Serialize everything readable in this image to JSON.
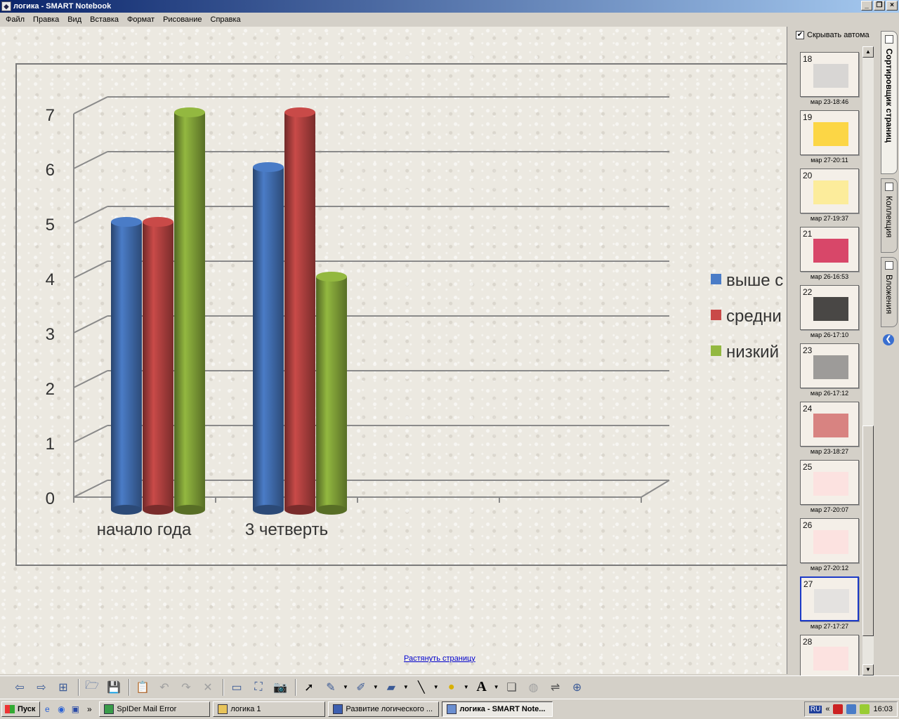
{
  "window": {
    "title": "логика - SMART Notebook",
    "app_icon": "smart-notebook-icon",
    "controls": [
      "_",
      "❐",
      "×"
    ]
  },
  "menu": [
    "Файл",
    "Правка",
    "Вид",
    "Вставка",
    "Формат",
    "Рисование",
    "Справка"
  ],
  "page": {
    "stretch_link": "Растянуть страницу"
  },
  "chart_data": {
    "type": "bar",
    "categories": [
      "начало года",
      "3 четверть"
    ],
    "series": [
      {
        "name": "выше с",
        "color": "#4a7cc7",
        "values": [
          5,
          6
        ]
      },
      {
        "name": "средни",
        "color": "#c94a48",
        "values": [
          5,
          7
        ]
      },
      {
        "name": "низкий",
        "color": "#93b840",
        "values": [
          7,
          4
        ]
      }
    ],
    "yticks": [
      "0",
      "1",
      "2",
      "3",
      "4",
      "5",
      "6",
      "7"
    ],
    "ylim": [
      0,
      7
    ],
    "grid": true,
    "legend": "right",
    "style": "3d-cylinder"
  },
  "sidebar": {
    "hide_label": "Скрывать автома",
    "hide_checked": true,
    "thumbs": [
      {
        "num": "18",
        "date": "мар 23-18:46",
        "selected": false
      },
      {
        "num": "19",
        "date": "мар 27-20:11",
        "selected": false
      },
      {
        "num": "20",
        "date": "мар 27-19:37",
        "selected": false
      },
      {
        "num": "21",
        "date": "мар 26-16:53",
        "selected": false
      },
      {
        "num": "22",
        "date": "мар 26-17:10",
        "selected": false
      },
      {
        "num": "23",
        "date": "мар 26-17:12",
        "selected": false
      },
      {
        "num": "24",
        "date": "мар 23-18:27",
        "selected": false
      },
      {
        "num": "25",
        "date": "мар 27-20:07",
        "selected": false
      },
      {
        "num": "26",
        "date": "мар 27-20:12",
        "selected": false
      },
      {
        "num": "27",
        "date": "мар 27-17:27",
        "selected": true
      },
      {
        "num": "28",
        "date": "",
        "selected": false
      }
    ]
  },
  "tabs": [
    "Сортировщик страниц",
    "Коллекция",
    "Вложения"
  ],
  "toolbar": {
    "icons": [
      "prev-page-icon",
      "next-page-icon",
      "add-page-icon",
      "open-file-icon",
      "save-icon",
      "paste-icon",
      "undo-icon",
      "redo-icon",
      "delete-icon",
      "screen-shade-icon",
      "full-screen-icon",
      "screen-capture-icon",
      "select-icon",
      "pen-icon",
      "creative-pen-icon",
      "eraser-icon",
      "line-icon",
      "shape-icon",
      "text-icon",
      "properties-icon",
      "fill-icon",
      "more-icon",
      "move-toolbar-icon"
    ],
    "text_glyph": "A"
  },
  "taskbar": {
    "start": "Пуск",
    "tasks": [
      {
        "label": "SpIDer Mail Error",
        "active": false
      },
      {
        "label": "логика 1",
        "active": false
      },
      {
        "label": "Развитие логического ...",
        "active": false
      },
      {
        "label": "логика - SMART Note...",
        "active": true
      }
    ],
    "lang": "RU",
    "chevron": "«",
    "clock": "16:03",
    "quick_more": "»"
  }
}
